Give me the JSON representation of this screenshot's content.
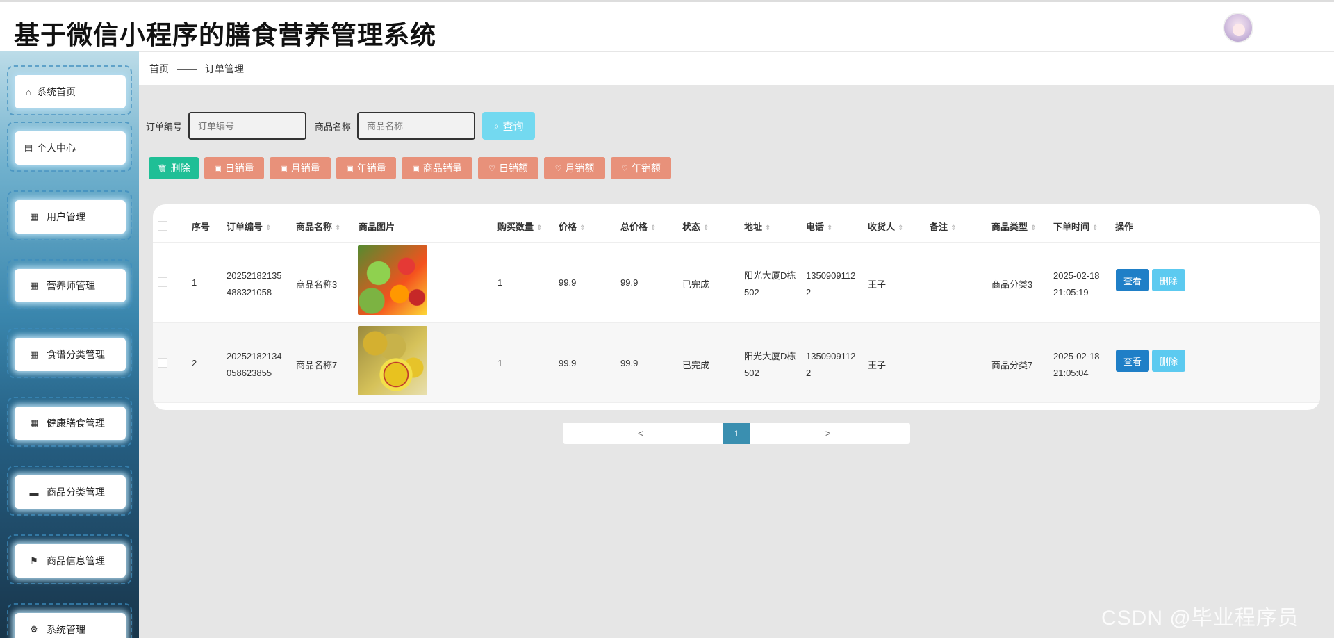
{
  "app": {
    "title": "基于微信小程序的膳食营养管理系统"
  },
  "sidebar": {
    "items": [
      {
        "label": "系统首页",
        "icon": "home-icon"
      },
      {
        "label": "个人中心",
        "icon": "id-card-icon"
      },
      {
        "label": "用户管理",
        "icon": "grid-icon"
      },
      {
        "label": "营养师管理",
        "icon": "grid-9-icon"
      },
      {
        "label": "食谱分类管理",
        "icon": "grid-icon"
      },
      {
        "label": "健康膳食管理",
        "icon": "grid-icon"
      },
      {
        "label": "商品分类管理",
        "icon": "monitor-icon"
      },
      {
        "label": "商品信息管理",
        "icon": "flag-icon"
      },
      {
        "label": "系统管理",
        "icon": "gear-icon"
      }
    ]
  },
  "breadcrumb": {
    "home": "首页",
    "separator": "——",
    "current": "订单管理"
  },
  "search": {
    "order_no_label": "订单编号",
    "order_no_placeholder": "订单编号",
    "product_name_label": "商品名称",
    "product_name_placeholder": "商品名称",
    "query_label": "查询"
  },
  "toolbar": {
    "delete_label": "删除",
    "buttons": [
      "日销量",
      "月销量",
      "年销量",
      "商品销量",
      "日销额",
      "月销额",
      "年销额"
    ]
  },
  "table": {
    "columns": [
      "序号",
      "订单编号",
      "商品名称",
      "商品图片",
      "购买数量",
      "价格",
      "总价格",
      "状态",
      "地址",
      "电话",
      "收货人",
      "备注",
      "商品类型",
      "下单时间",
      "操作"
    ],
    "rows": [
      {
        "index": "1",
        "order_no_1": "20252182135",
        "order_no_2": "488321058",
        "product_name": "商品名称3",
        "image": "vegetables-image",
        "qty": "1",
        "price": "99.9",
        "total": "99.9",
        "status": "已完成",
        "address_1": "阳光大厦D栋",
        "address_2": "502",
        "phone_1": "1350909112",
        "phone_2": "2",
        "receiver": "王子",
        "remark": "",
        "type": "商品分类3",
        "time_1": "2025-02-18",
        "time_2": "21:05:19",
        "view_label": "查看",
        "delete_label": "删除"
      },
      {
        "index": "2",
        "order_no_1": "20252182134",
        "order_no_2": "058623855",
        "product_name": "商品名称7",
        "image": "kiwi-image",
        "qty": "1",
        "price": "99.9",
        "total": "99.9",
        "status": "已完成",
        "address_1": "阳光大厦D栋",
        "address_2": "502",
        "phone_1": "1350909112",
        "phone_2": "2",
        "receiver": "王子",
        "remark": "",
        "type": "商品分类7",
        "time_1": "2025-02-18",
        "time_2": "21:05:04",
        "view_label": "查看",
        "delete_label": "删除"
      }
    ]
  },
  "pagination": {
    "prev": "<",
    "current": "1",
    "next": ">"
  },
  "watermark": "CSDN @毕业程序员",
  "colors": {
    "delete_green": "#1fbf96",
    "stat_salmon": "#e8917a",
    "query_cyan": "#73d9f0",
    "view_blue": "#1f7fc7",
    "row_delete_cyan": "#5ccaf0",
    "pager_active": "#3a8fb0"
  }
}
